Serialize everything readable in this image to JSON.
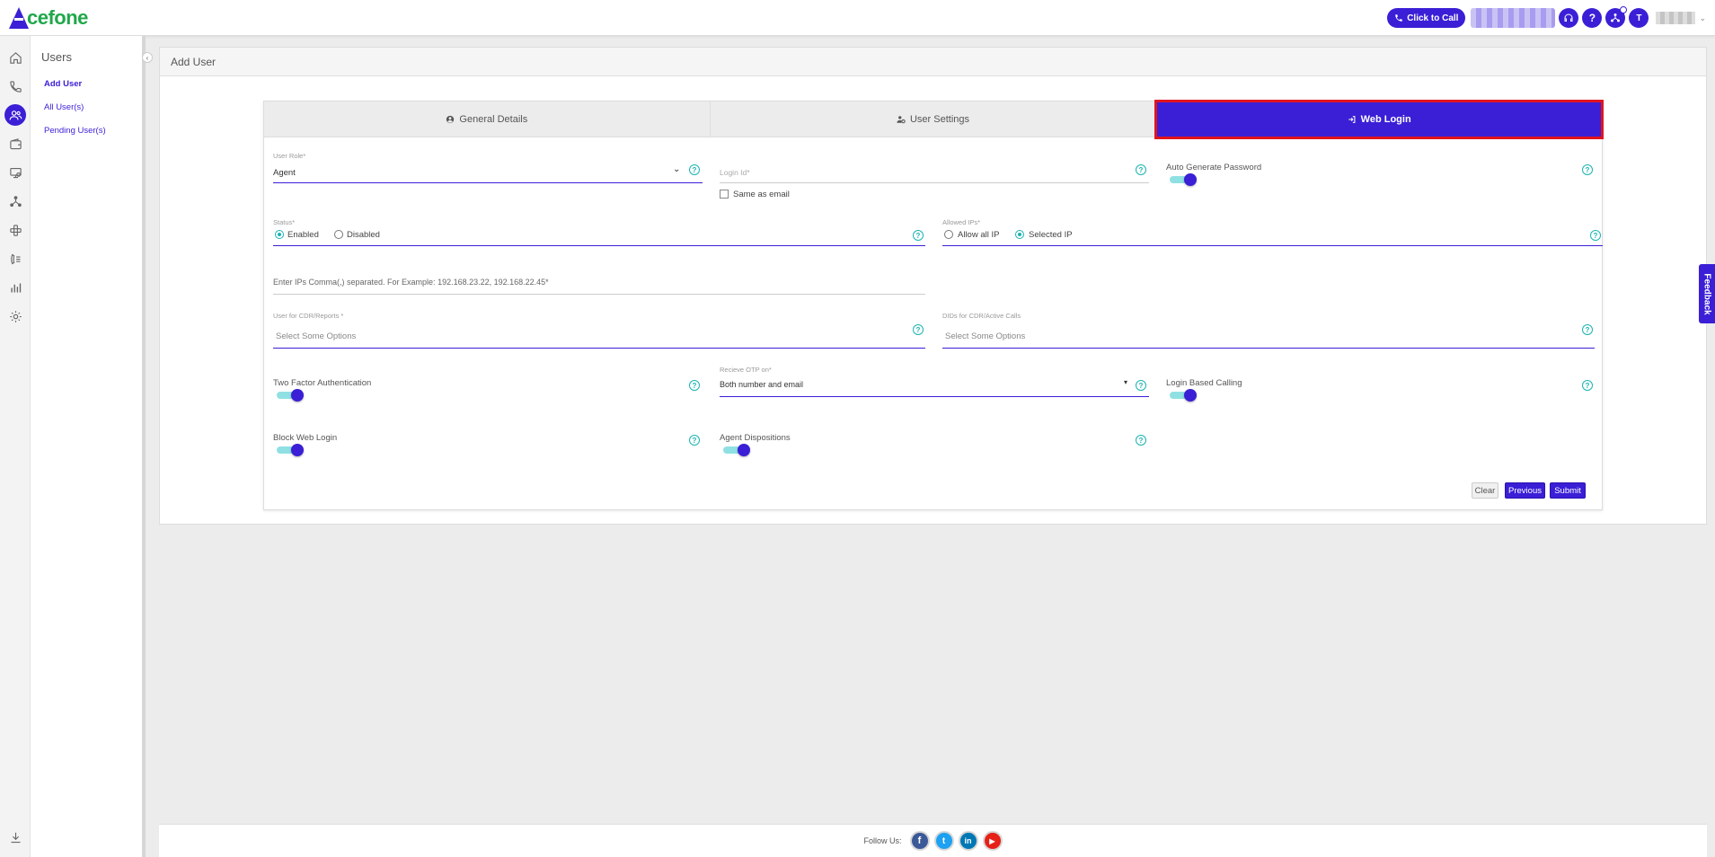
{
  "header": {
    "logo_text": "cefone",
    "click_to_call": "Click to Call",
    "help_label": "?",
    "avatar_initial": "T"
  },
  "submenu": {
    "title": "Users",
    "items": [
      {
        "label": "Add User"
      },
      {
        "label": "All User(s)"
      },
      {
        "label": "Pending User(s)"
      }
    ]
  },
  "page": {
    "title": "Add User"
  },
  "tabs": [
    {
      "label": "General Details",
      "icon": "user-circle-icon"
    },
    {
      "label": "User Settings",
      "icon": "users-gear-icon"
    },
    {
      "label": "Web Login",
      "icon": "login-icon",
      "active": true
    }
  ],
  "form": {
    "user_role": {
      "label": "User Role*",
      "value": "Agent"
    },
    "login_id": {
      "label": "Login Id*",
      "same_as_email": "Same as email"
    },
    "auto_generate_password": {
      "label": "Auto Generate Password"
    },
    "status": {
      "label": "Status*",
      "options": [
        "Enabled",
        "Disabled"
      ],
      "selected": "Enabled"
    },
    "allowed_ips": {
      "label": "Allowed IPs*",
      "options": [
        "Allow all IP",
        "Selected IP"
      ],
      "selected": "Selected IP"
    },
    "ips_input": {
      "placeholder": "Enter IPs Comma(,) separated. For Example: 192.168.23.22, 192.168.22.45*"
    },
    "user_for_cdr": {
      "label": "User for CDR/Reports *",
      "placeholder": "Select Some Options"
    },
    "dids_for_cdr": {
      "label": "DIDs for CDR/Active Calls",
      "placeholder": "Select Some Options"
    },
    "two_factor": {
      "label": "Two Factor Authentication"
    },
    "receive_otp": {
      "label": "Recieve OTP on*",
      "value": "Both number and email"
    },
    "login_based_calling": {
      "label": "Login Based Calling"
    },
    "block_web_login": {
      "label": "Block Web Login"
    },
    "agent_dispositions": {
      "label": "Agent Dispositions"
    },
    "help_glyph": "?"
  },
  "buttons": {
    "clear": "Clear",
    "previous": "Previous",
    "submit": "Submit"
  },
  "feedback": "Feedback",
  "footer": {
    "follow_us": "Follow Us:",
    "social": [
      "f",
      "t",
      "in",
      "▶"
    ]
  },
  "colors": {
    "brand": "#3a1fd6",
    "logo_green": "#1fa84a",
    "accent_teal": "#1bb3b3",
    "tab_highlight": "#e0141e"
  }
}
